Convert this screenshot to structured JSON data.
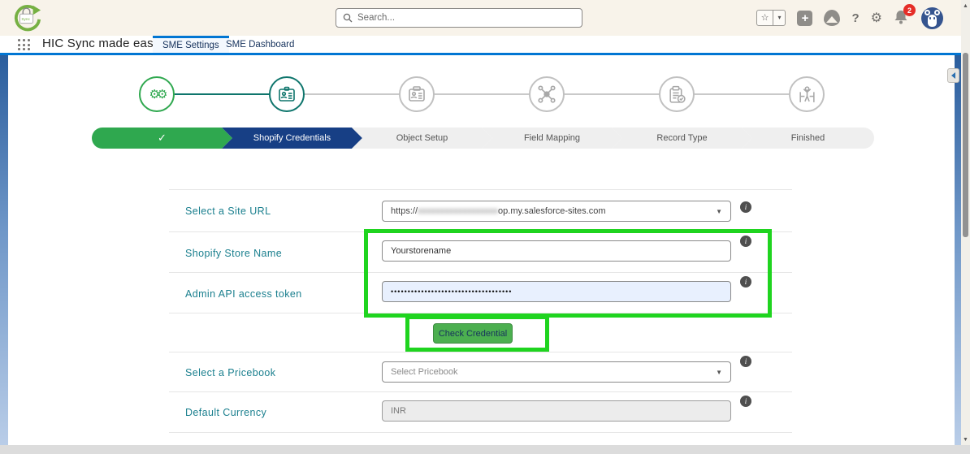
{
  "header": {
    "search": {
      "placeholder": "Search..."
    },
    "notifications": {
      "badge_count": "2"
    }
  },
  "nav": {
    "app_name": "HIC Sync made easy",
    "tabs": [
      {
        "label": "SME Settings",
        "active": true
      },
      {
        "label": "SME Dashboard",
        "active": false
      }
    ]
  },
  "wizard": {
    "chevrons": [
      {
        "label": "✓",
        "state": "completed"
      },
      {
        "label": "Shopify Credentials",
        "state": "current"
      },
      {
        "label": "Object Setup",
        "state": "upcoming"
      },
      {
        "label": "Field Mapping",
        "state": "upcoming"
      },
      {
        "label": "Record Type",
        "state": "upcoming"
      },
      {
        "label": "Finished",
        "state": "upcoming"
      }
    ]
  },
  "form": {
    "site_url": {
      "label": "Select a Site URL",
      "value_prefix": "https://",
      "value_redacted": "xxxxxxxxxxxxxxxxxx",
      "value_suffix": "op.my.salesforce-sites.com"
    },
    "store_name": {
      "label": "Shopify Store Name",
      "value": "Yourstorename"
    },
    "api_token": {
      "label": "Admin API access token",
      "value": "••••••••••••••••••••••••••••••••••••"
    },
    "check_button": {
      "label": "Check Credential"
    },
    "pricebook": {
      "label": "Select a Pricebook",
      "value": "Select Pricebook"
    },
    "currency": {
      "label": "Default Currency",
      "value": "INR"
    }
  },
  "icons": {
    "star": "☆",
    "caret_down": "▾",
    "plus": "+",
    "question": "?",
    "gear": "⚙",
    "select_caret": "▼",
    "scroll_up": "▲",
    "scroll_down": "▼",
    "info": "i",
    "gears": "⚙⚙"
  },
  "colors": {
    "accent_green": "#2fa84f",
    "accent_navy": "#173f85",
    "annotation_green": "#1fd41f",
    "label_teal": "#1a7f8e",
    "tab_blue": "#0176d3",
    "button_green": "#4caf50"
  }
}
